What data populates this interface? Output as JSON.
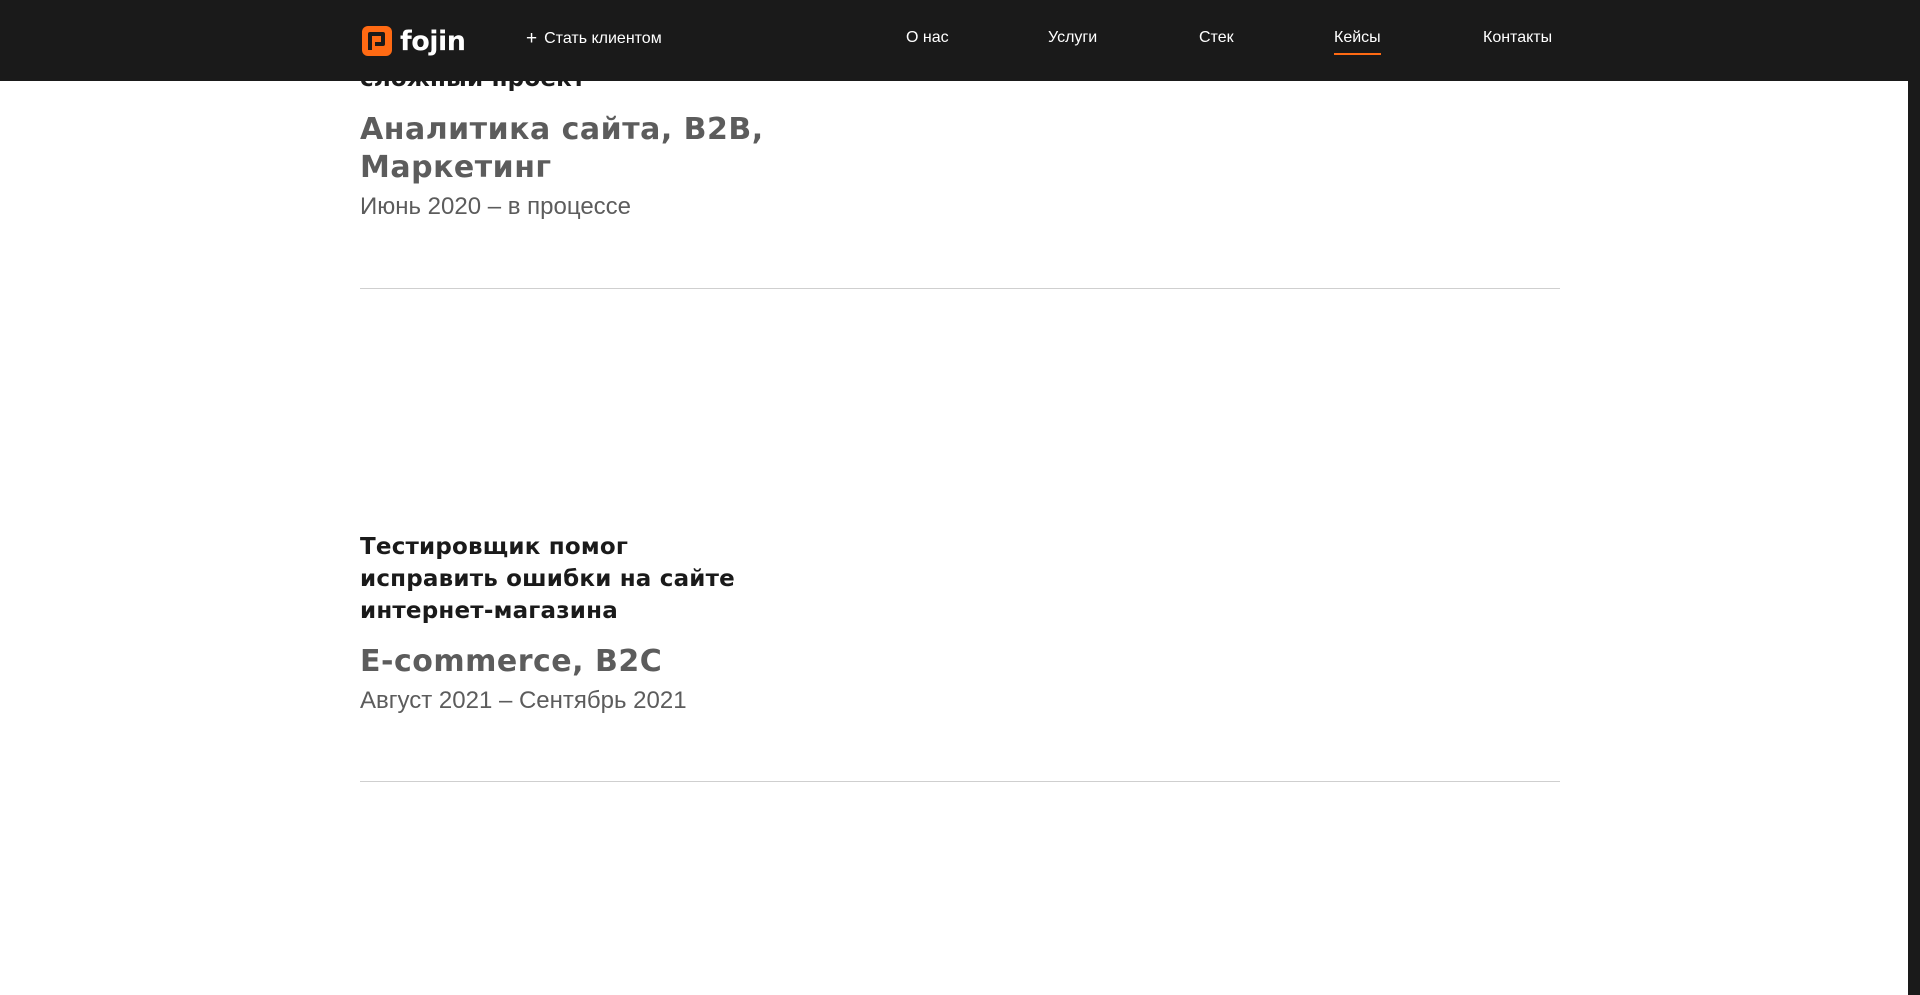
{
  "header": {
    "logo_text": "fojin",
    "become_client_label": "Стать клиентом",
    "nav": [
      {
        "label": "О нас"
      },
      {
        "label": "Услуги"
      },
      {
        "label": "Стек"
      },
      {
        "label": "Кейсы",
        "active": true
      },
      {
        "label": "Контакты"
      }
    ],
    "accent_color": "#ff6a13"
  },
  "cases": [
    {
      "title": "сложный проект",
      "tags": "Аналитика сайта, B2B, Маркетинг",
      "dates": "Июнь 2020 – в процессе"
    },
    {
      "title": "Тестировщик помог исправить ошибки на сайте интернет-магазина",
      "tags": "E-commerce, B2C",
      "dates": "Август 2021 – Сентябрь 2021"
    }
  ]
}
